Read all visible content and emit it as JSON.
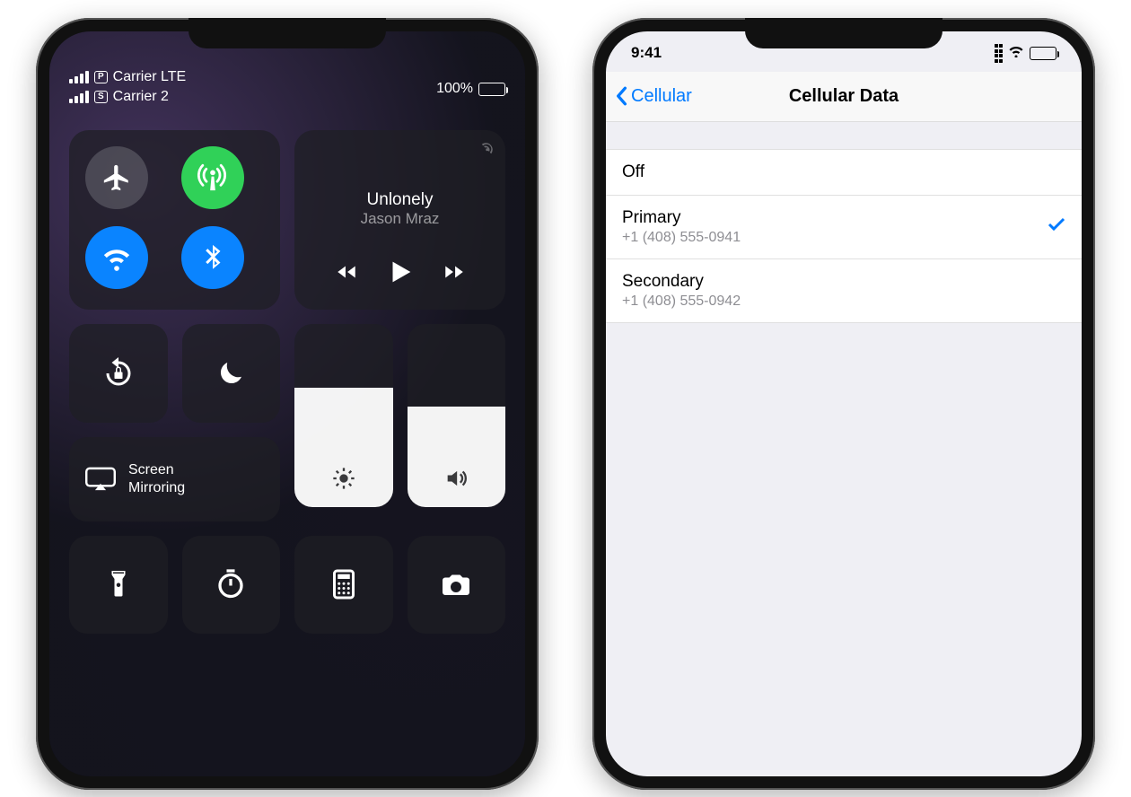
{
  "control_center": {
    "status": {
      "carrier1_tag": "P",
      "carrier1_label": "Carrier LTE",
      "carrier2_tag": "S",
      "carrier2_label": "Carrier 2",
      "battery_pct": "100%"
    },
    "media": {
      "title": "Unlonely",
      "artist": "Jason Mraz"
    },
    "mirroring_line1": "Screen",
    "mirroring_line2": "Mirroring",
    "brightness_fill_pct": 65,
    "volume_fill_pct": 55,
    "toggles": {
      "airplane": false,
      "cellular": true,
      "wifi": true,
      "bluetooth": true
    }
  },
  "settings": {
    "status_time": "9:41",
    "back_label": "Cellular",
    "title": "Cellular Data",
    "options": {
      "off_label": "Off",
      "primary_label": "Primary",
      "primary_number": "+1 (408) 555-0941",
      "secondary_label": "Secondary",
      "secondary_number": "+1 (408) 555-0942",
      "selected": "primary"
    }
  }
}
